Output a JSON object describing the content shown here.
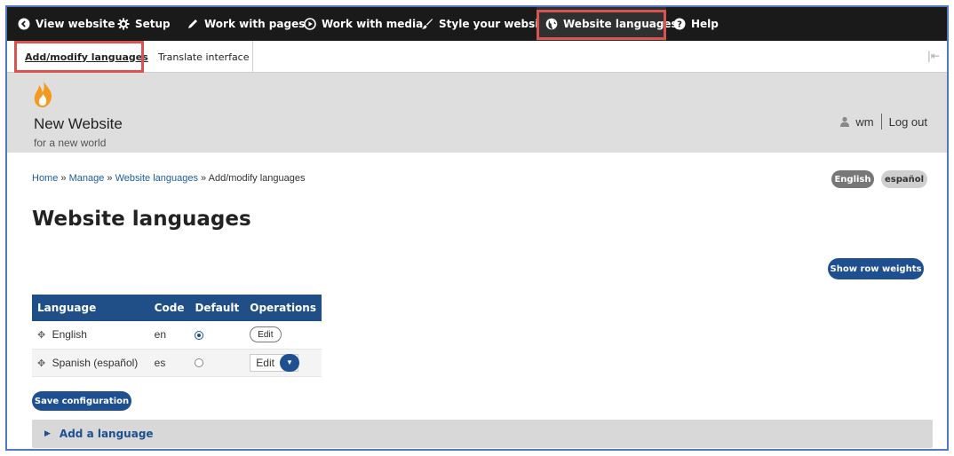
{
  "toolbar": {
    "items": [
      {
        "label": "View website",
        "icon": "chevron-left-circle-icon"
      },
      {
        "label": "Setup",
        "icon": "gear-icon"
      },
      {
        "label": "Work with pages",
        "icon": "pencil-icon"
      },
      {
        "label": "Work with media",
        "icon": "play-circle-icon"
      },
      {
        "label": "Style your website",
        "icon": "paintbrush-icon"
      },
      {
        "label": "Website languages",
        "icon": "globe-icon"
      },
      {
        "label": "Help",
        "icon": "question-circle-icon"
      }
    ],
    "active": "Website languages"
  },
  "subtabs": {
    "items": [
      {
        "label": "Add/modify languages",
        "active": true
      },
      {
        "label": "Translate interface",
        "active": false
      }
    ]
  },
  "header": {
    "logo_icon": "flame-icon",
    "site_name": "New Website",
    "slogan": "for a new world",
    "user": "wm",
    "logout": "Log out"
  },
  "breadcrumb": {
    "items": [
      "Home",
      "Manage",
      "Website languages",
      "Add/modify languages"
    ],
    "separator": "»"
  },
  "language_switcher": [
    {
      "label": "English",
      "active": true
    },
    {
      "label": "español",
      "active": false
    }
  ],
  "page_title": "Website languages",
  "show_row_weights_label": "Show row weights",
  "table": {
    "columns": [
      "Language",
      "Code",
      "Default",
      "Operations"
    ],
    "rows": [
      {
        "language": "English",
        "code": "en",
        "default": true,
        "operation": "Edit"
      },
      {
        "language": "Spanish (español)",
        "code": "es",
        "default": false,
        "operation": "Edit"
      }
    ]
  },
  "save_label": "Save configuration",
  "add_language_label": "Add a language",
  "colors": {
    "toolbar_bg": "#1a1a1a",
    "accent": "#1d4f91",
    "highlight": "#d9534f",
    "header_bg": "#dedede",
    "table_header": "#1f4f86"
  }
}
